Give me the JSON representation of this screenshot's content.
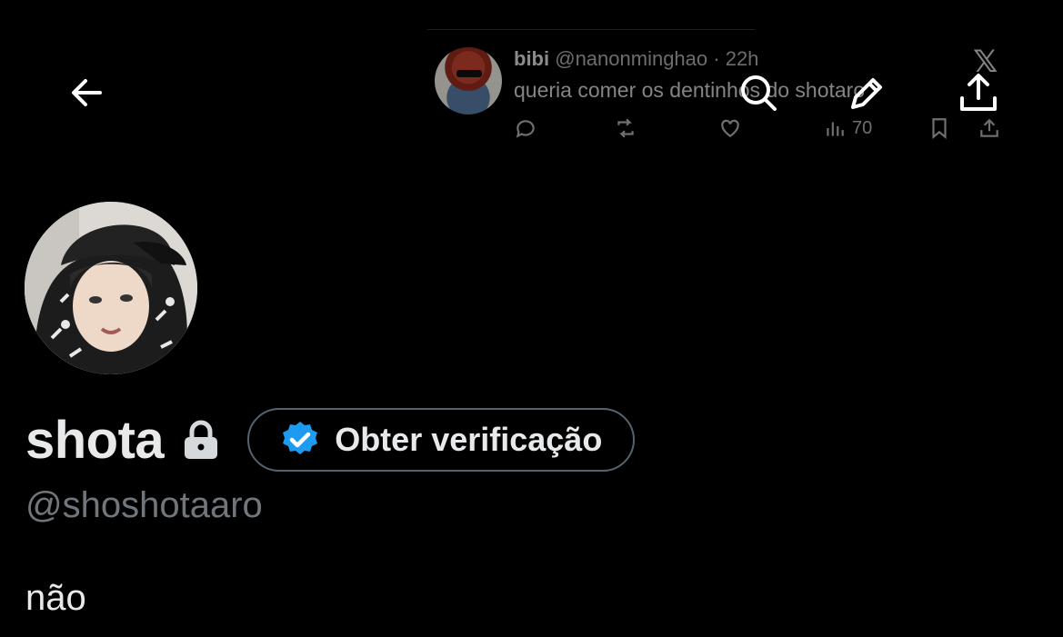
{
  "embedded_tweet": {
    "name": "bibi",
    "handle": "@nanonminghao",
    "time": "· 22h",
    "text": "queria comer os dentinhos do shotaro",
    "views": "70",
    "platform_logo": "𝕏"
  },
  "header": {
    "back_icon": "arrow-left-icon",
    "search_icon": "search-icon",
    "compose_icon": "pencil-icon",
    "share_icon": "share-icon"
  },
  "profile": {
    "display_name": "shota",
    "verify_label": "Obter verificação",
    "handle": "@shoshotaaro",
    "bio": "não",
    "badge_color": "#1d9bf0"
  }
}
